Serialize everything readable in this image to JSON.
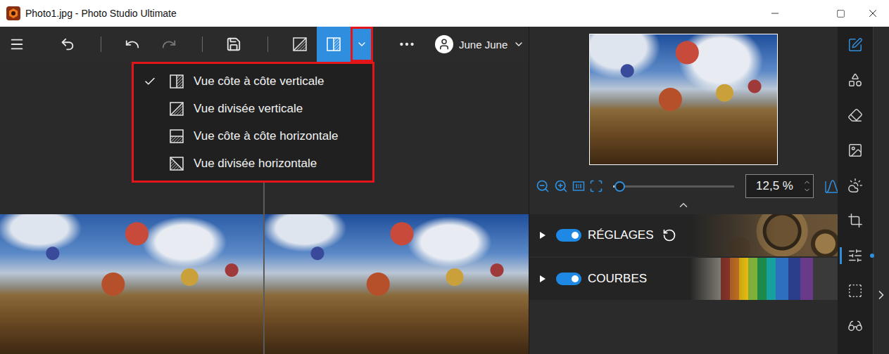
{
  "window": {
    "title": "Photo1.jpg - Photo Studio Ultimate"
  },
  "history": {
    "undo_disabled": false,
    "redo_disabled": true
  },
  "view_modes": [
    {
      "kind": "split-vertical",
      "selected": false
    },
    {
      "kind": "side-vertical",
      "selected": true
    }
  ],
  "view_dropdown": {
    "annotated": true
  },
  "user": {
    "name": "June June"
  },
  "view_menu": {
    "open": true,
    "annotated": true,
    "items": [
      {
        "label": "Vue côte à côte verticale",
        "kind": "side-vertical",
        "checked": true
      },
      {
        "label": "Vue divisée verticale",
        "kind": "split-vertical",
        "checked": false
      },
      {
        "label": "Vue côte à côte horizontale",
        "kind": "side-horizontal",
        "checked": false
      },
      {
        "label": "Vue divisée horizontale",
        "kind": "split-horizontal",
        "checked": false
      }
    ]
  },
  "preview": {
    "zoom": "12,5 %",
    "level": 0.05
  },
  "panels": [
    {
      "label": "RÉGLAGES",
      "kind": "gears",
      "enabled": true,
      "expanded": false,
      "resettable": true
    },
    {
      "label": "COURBES",
      "kind": "pencils",
      "enabled": true,
      "expanded": false,
      "resettable": false
    }
  ],
  "tools": [
    {
      "kind": "edit",
      "selected": false,
      "highlighted": true
    },
    {
      "kind": "text",
      "selected": false,
      "highlighted": false
    },
    {
      "kind": "eraser",
      "selected": false,
      "highlighted": false
    },
    {
      "kind": "frame",
      "selected": false,
      "highlighted": false
    },
    {
      "kind": "weather",
      "selected": false,
      "highlighted": false
    },
    {
      "kind": "crop",
      "selected": false,
      "highlighted": false
    },
    {
      "kind": "adjust",
      "selected": true,
      "highlighted": false
    },
    {
      "kind": "select",
      "selected": false,
      "highlighted": false
    },
    {
      "kind": "glasses",
      "selected": false,
      "highlighted": false
    }
  ]
}
